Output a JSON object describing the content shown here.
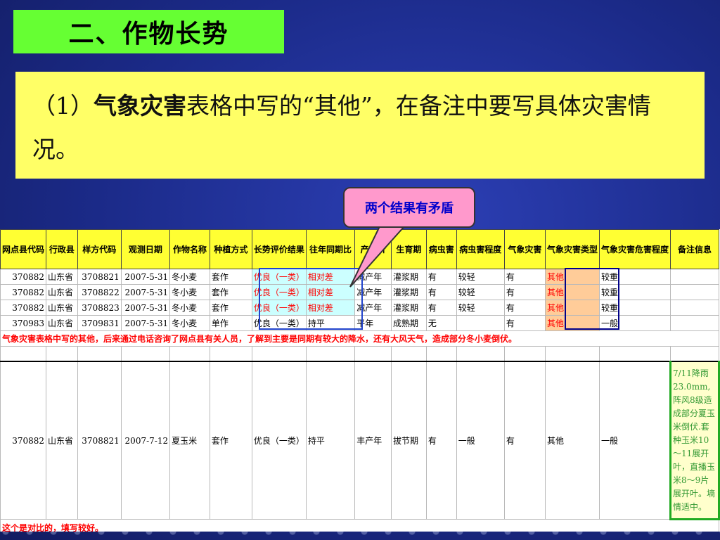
{
  "title": "二、作物长势",
  "note": {
    "prefix": "（1）",
    "bold": "气象灾害",
    "rest": "表格中写的“其他”，在备注中要写具体灾害情况。"
  },
  "callout": "两个结果有矛盾",
  "table": {
    "headers": [
      "网点县代码",
      "行政县",
      "样方代码",
      "观测日期",
      "作物名称",
      "种植方式",
      "长势评价结果",
      "往年同期比",
      "产评价",
      "生育期",
      "病虫害",
      "病虫害程度",
      "气象灾害",
      "气象灾害类型",
      "气象灾害危害程度",
      "备注信息"
    ],
    "rows": [
      [
        "370882",
        "山东省",
        "3708821",
        "2007-5-31",
        "冬小麦",
        "套作",
        "优良（一类）",
        "相对差",
        "减产年",
        "灌浆期",
        "有",
        "较轻",
        "有",
        "其他",
        "较重",
        ""
      ],
      [
        "370882",
        "山东省",
        "3708822",
        "2007-5-31",
        "冬小麦",
        "套作",
        "优良（一类）",
        "相对差",
        "减产年",
        "灌浆期",
        "有",
        "较轻",
        "有",
        "其他",
        "较重",
        ""
      ],
      [
        "370882",
        "山东省",
        "3708823",
        "2007-5-31",
        "冬小麦",
        "套作",
        "优良（一类）",
        "相对差",
        "减产年",
        "灌浆期",
        "有",
        "较轻",
        "有",
        "其他",
        "较重",
        ""
      ],
      [
        "370983",
        "山东省",
        "3709831",
        "2007-5-31",
        "冬小麦",
        "单作",
        "优良（一类）",
        "持平",
        "平年",
        "成熟期",
        "无",
        "",
        "有",
        "其他",
        "一般",
        ""
      ]
    ],
    "message1": "气象灾害表格中写的其他，后来通过电话咨询了网点县有关人员，了解到主要是同期有较大的降水，还有大风天气，造成部分冬小麦倒伏。",
    "row2": [
      "370882",
      "山东省",
      "3708821",
      "2007-7-12",
      "夏玉米",
      "套作",
      "优良（一类）",
      "持平",
      "丰产年",
      "拔节期",
      "有",
      "一般",
      "有",
      "其他",
      "一般"
    ],
    "remark": "7/11降雨23.0mm,阵风8级造成部分夏玉米倒伏.套种玉米10～11展开叶，直播玉米8～9片展开叶。墒情适中。",
    "message2": "这个是对比的，填写较好。"
  },
  "colors": {
    "background": "#1f2d8f",
    "title_bg": "#66ff33",
    "note_bg": "#ffff66",
    "callout_bg": "#ff99cc",
    "callout_text": "#0000cc",
    "header_bg": "#ffff33",
    "highlight_blue": "#ccffff",
    "highlight_orange": "#ffcc99",
    "alert_red": "#ff0000"
  }
}
